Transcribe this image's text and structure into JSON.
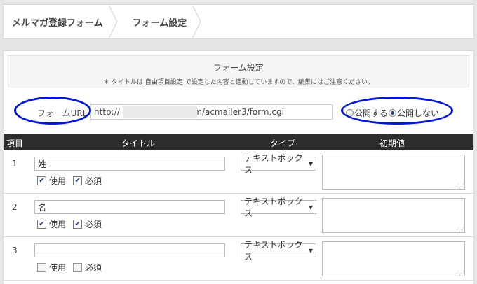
{
  "breadcrumb": {
    "items": [
      "メルマガ登録フォーム",
      "フォーム設定"
    ]
  },
  "panel": {
    "title": "フォーム設定",
    "note_prefix": "＊ タイトルは",
    "note_link": "自由項目設定",
    "note_suffix": "で設定した内容と連動していますので、編集にはご注意ください。"
  },
  "form_url": {
    "label": "フォームURL",
    "value": "http://                       .com/acmailer3/form.cgi"
  },
  "visibility": {
    "options": [
      "公開する",
      "公開しない"
    ],
    "selected_index": 1
  },
  "table": {
    "headers": {
      "item": "項目",
      "title": "タイトル",
      "type": "タイプ",
      "initial": "初期値"
    },
    "rows": [
      {
        "num": "1",
        "title": "姓",
        "use_label": "使用",
        "required_label": "必須",
        "use": true,
        "required": true,
        "type": "テキストボックス",
        "initial": ""
      },
      {
        "num": "2",
        "title": "名",
        "use_label": "使用",
        "required_label": "必須",
        "use": true,
        "required": true,
        "type": "テキストボックス",
        "initial": ""
      },
      {
        "num": "3",
        "title": "",
        "use_label": "使用",
        "required_label": "必須",
        "use": false,
        "required": false,
        "type": "テキストボックス",
        "initial": ""
      }
    ]
  },
  "colors": {
    "annotation_ellipse": "#0015d6",
    "table_header_bg": "#2d2d2d"
  }
}
